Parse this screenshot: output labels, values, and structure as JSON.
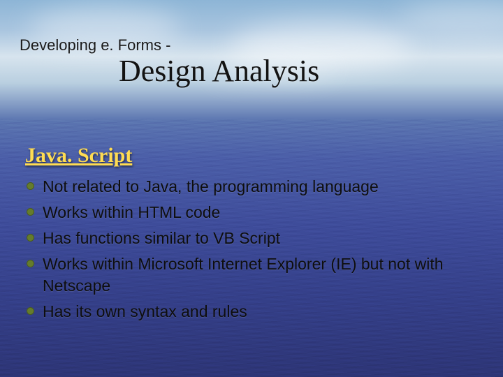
{
  "kicker": "Developing e. Forms -",
  "title": "Design Analysis",
  "heading": "Java. Script",
  "bullets": [
    "Not related to Java, the programming language",
    "Works within HTML code",
    "Has functions similar to VB Script",
    "Works within Microsoft Internet Explorer (IE) but not with Netscape",
    "Has its own syntax and rules"
  ]
}
